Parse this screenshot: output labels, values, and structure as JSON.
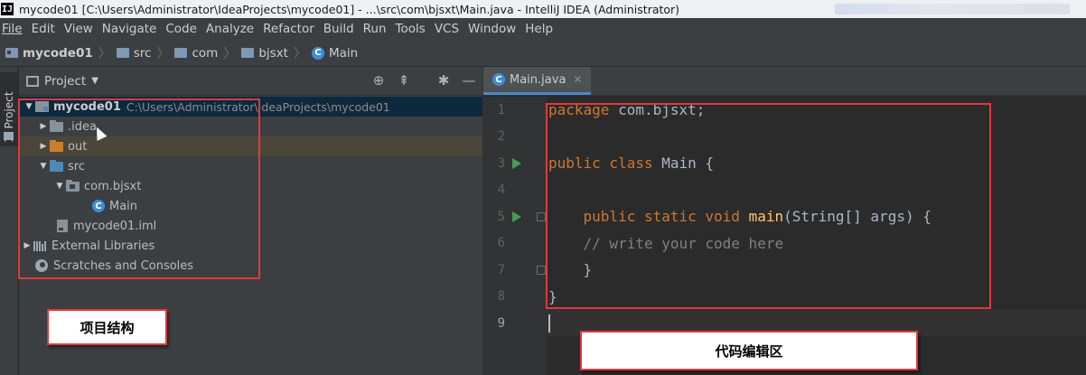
{
  "window": {
    "title": "mycode01 [C:\\Users\\Administrator\\IdeaProjects\\mycode01] - ...\\src\\com\\bjsxt\\Main.java - IntelliJ IDEA (Administrator)",
    "app_icon": "IJ"
  },
  "menu": [
    "File",
    "Edit",
    "View",
    "Navigate",
    "Code",
    "Analyze",
    "Refactor",
    "Build",
    "Run",
    "Tools",
    "VCS",
    "Window",
    "Help"
  ],
  "breadcrumb": {
    "items": [
      "mycode01",
      "src",
      "com",
      "bjsxt",
      "Main"
    ]
  },
  "side_stripe": {
    "label": "1: Project"
  },
  "project_panel": {
    "header": "Project",
    "tools": [
      "target-icon",
      "collapse-icon",
      "settings-icon",
      "hide-icon"
    ],
    "tree": [
      {
        "label": "mycode01",
        "path": "C:\\Users\\Administrator\\IdeaProjects\\mycode01"
      },
      {
        "label": ".idea"
      },
      {
        "label": "out"
      },
      {
        "label": "src"
      },
      {
        "label": "com.bjsxt"
      },
      {
        "label": "Main"
      },
      {
        "label": "mycode01.iml"
      },
      {
        "label": "External Libraries"
      },
      {
        "label": "Scratches and Consoles"
      }
    ],
    "annotation": "项目结构"
  },
  "editor": {
    "tab": "Main.java",
    "lines": [
      {
        "n": "1",
        "parts": [
          {
            "t": "package",
            "c": "kw"
          },
          {
            "t": " com.bjsxt;",
            "c": ""
          }
        ]
      },
      {
        "n": "2",
        "parts": []
      },
      {
        "n": "3",
        "parts": [
          {
            "t": "public class",
            "c": "kw"
          },
          {
            "t": " Main {",
            "c": ""
          }
        ]
      },
      {
        "n": "4",
        "parts": []
      },
      {
        "n": "5",
        "parts": [
          {
            "t": "    ",
            "c": ""
          },
          {
            "t": "public static void",
            "c": "kw"
          },
          {
            "t": " ",
            "c": ""
          },
          {
            "t": "main",
            "c": "fn"
          },
          {
            "t": "(String[] args) {",
            "c": ""
          }
        ]
      },
      {
        "n": "6",
        "parts": [
          {
            "t": "    ",
            "c": ""
          },
          {
            "t": "// write your code here",
            "c": "cm"
          }
        ]
      },
      {
        "n": "7",
        "parts": [
          {
            "t": "    }",
            "c": ""
          }
        ]
      },
      {
        "n": "8",
        "parts": [
          {
            "t": "}",
            "c": ""
          }
        ]
      },
      {
        "n": "9",
        "parts": []
      }
    ],
    "annotation": "代码编辑区"
  }
}
